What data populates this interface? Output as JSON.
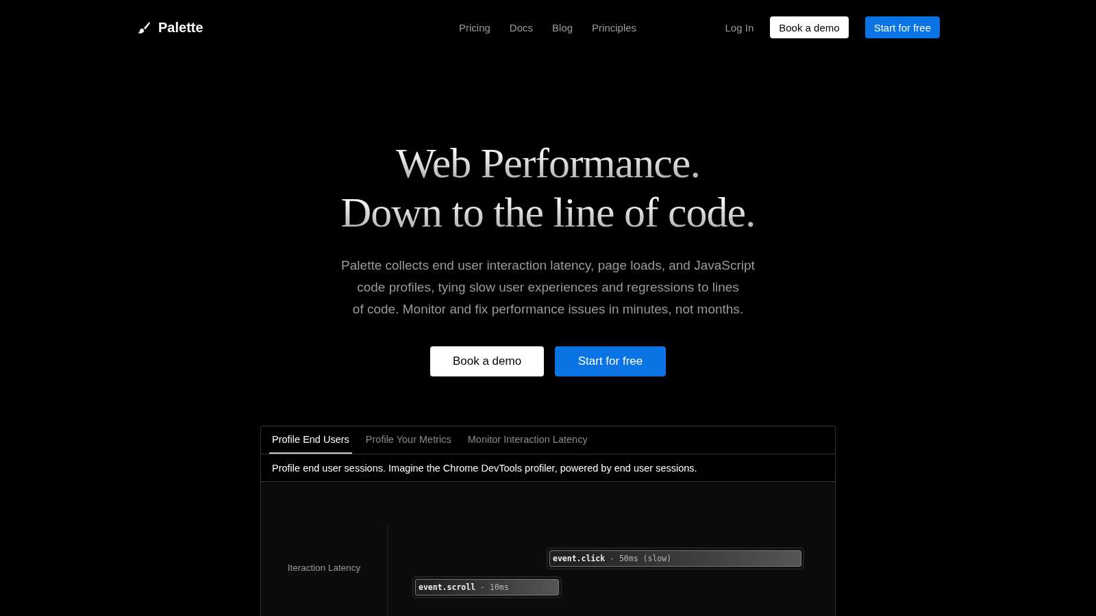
{
  "nav": {
    "logo": "Palette",
    "links": [
      "Pricing",
      "Docs",
      "Blog",
      "Principles"
    ],
    "login": "Log In",
    "demo": "Book a demo",
    "start": "Start for free"
  },
  "hero": {
    "title_lines": [
      "Web Performance.",
      "Down to the line of code."
    ],
    "text_lines": [
      "Palette collects end user interaction latency, page loads, and JavaScript",
      "code profiles, tying slow user experiences and regressions to lines",
      "of code. Monitor and fix performance issues in minutes, not months."
    ],
    "demo": "Book a demo",
    "start": "Start for free"
  },
  "panel": {
    "tabs": [
      {
        "label": "Profile End Users",
        "selected": true
      },
      {
        "label": "Profile Your Metrics",
        "selected": false
      },
      {
        "label": "Monitor Interaction Latency",
        "selected": false
      }
    ],
    "description": "Profile end user sessions. Imagine the Chrome DevTools profiler, powered by end user sessions.",
    "row_label": "Iteraction Latency",
    "events": [
      {
        "name": "event.click",
        "detail": " - 50ms (slow)"
      },
      {
        "name": "event.scroll",
        "detail": " - 10ms"
      }
    ]
  }
}
